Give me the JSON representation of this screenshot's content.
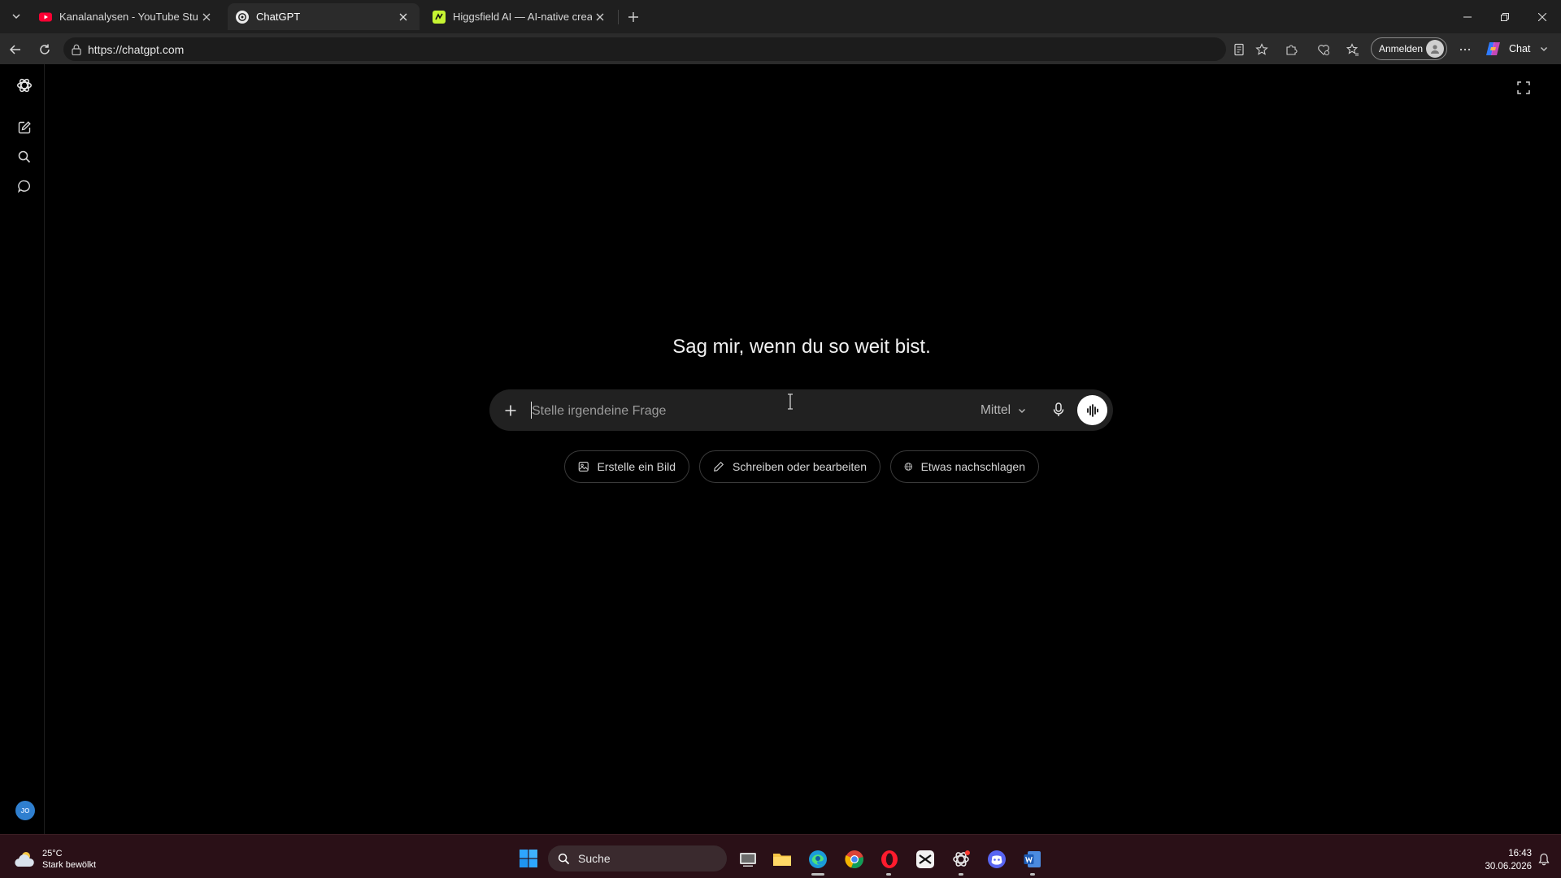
{
  "browser": {
    "tabs": [
      {
        "title": "Kanalanalysen - YouTube Studio",
        "icon": "youtube-icon",
        "active": false
      },
      {
        "title": "ChatGPT",
        "icon": "chatgpt-icon",
        "active": true
      },
      {
        "title": "Higgsfield AI — AI-native creative",
        "icon": "higgsfield-icon",
        "active": false
      }
    ],
    "url": "https://chatgpt.com",
    "signin_label": "Anmelden",
    "copilot_label": "Chat"
  },
  "chat": {
    "headline": "Sag mir, wenn du so weit bist.",
    "input_placeholder": "Stelle irgendeine Frage",
    "model_label": "Mittel",
    "suggestions": [
      {
        "label": "Erstelle ein Bild",
        "icon": "image-icon"
      },
      {
        "label": "Schreiben oder bearbeiten",
        "icon": "pencil-icon"
      },
      {
        "label": "Etwas nachschlagen",
        "icon": "globe-icon"
      }
    ],
    "user_initials": "JO"
  },
  "taskbar": {
    "weather_temp": "25°C",
    "weather_desc": "Stark bewölkt",
    "search_label": "Suche",
    "time": "16:43",
    "date": "30.06.2026"
  },
  "colors": {
    "page_bg": "#000000",
    "composer_bg": "#212121",
    "taskbar_bg": "#2a1017",
    "accent_avatar": "#2f7fcf"
  }
}
